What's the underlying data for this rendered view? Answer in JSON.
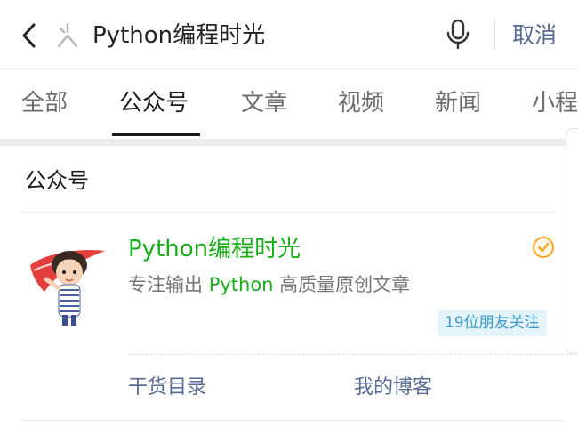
{
  "search": {
    "query": "Python编程时光",
    "cancel_label": "取消"
  },
  "tabs": [
    {
      "label": "全部"
    },
    {
      "label": "公众号"
    },
    {
      "label": "文章"
    },
    {
      "label": "视频"
    },
    {
      "label": "新闻"
    },
    {
      "label": "小程"
    }
  ],
  "active_tab": "公众号",
  "results": {
    "section_title": "公众号",
    "account": {
      "name": "Python编程时光",
      "desc_prefix": "专注输出 ",
      "desc_highlight": "Python",
      "desc_suffix": " 高质量原创文章",
      "friends_badge": "19位朋友关注",
      "verified": true
    },
    "links": [
      {
        "label": "干货目录"
      },
      {
        "label": "我的博客"
      }
    ]
  },
  "colors": {
    "accent_green": "#1aad19",
    "link_blue": "#576b95",
    "badge_bg": "#e3f4fa",
    "badge_text": "#3d98c7",
    "verified_orange": "#f5a623"
  }
}
